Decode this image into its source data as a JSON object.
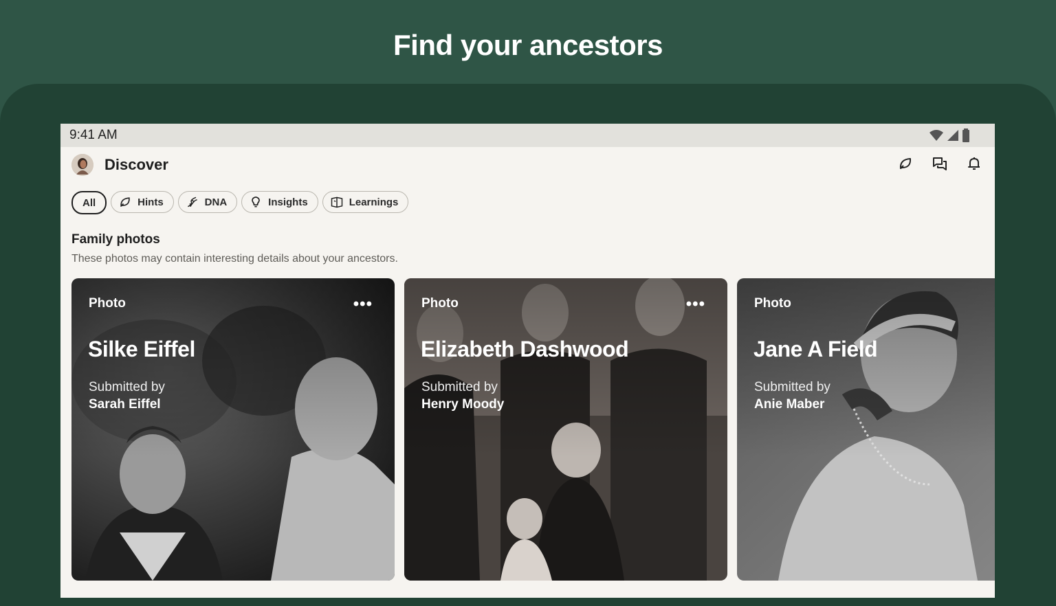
{
  "headline": "Find your ancestors",
  "status_bar": {
    "time": "9:41 AM",
    "icons": [
      "wifi-icon",
      "signal-icon",
      "battery-icon"
    ]
  },
  "app_bar": {
    "title": "Discover",
    "actions": [
      "hint-leaf-icon",
      "messages-icon",
      "notifications-bell-icon"
    ]
  },
  "chips": [
    {
      "label": "All",
      "icon": ""
    },
    {
      "label": "Hints",
      "icon": "leaf-icon"
    },
    {
      "label": "DNA",
      "icon": "dna-icon"
    },
    {
      "label": "Insights",
      "icon": "lightbulb-icon"
    },
    {
      "label": "Learnings",
      "icon": "book-icon"
    }
  ],
  "section": {
    "title": "Family photos",
    "description": "These photos may contain interesting details about your ancestors."
  },
  "cards": [
    {
      "kind": "Photo",
      "name": "Silke Eiffel",
      "submitted_label": "Submitted by",
      "submitter": "Sarah Eiffel",
      "more": "•••"
    },
    {
      "kind": "Photo",
      "name": "Elizabeth Dashwood",
      "submitted_label": "Submitted by",
      "submitter": "Henry Moody",
      "more": "•••"
    },
    {
      "kind": "Photo",
      "name": "Jane A Field",
      "submitted_label": "Submitted by",
      "submitter": "Anie Maber",
      "more": ""
    }
  ],
  "colors": {
    "background": "#2f5546",
    "frame": "#214234",
    "screen": "#f6f4f0"
  }
}
